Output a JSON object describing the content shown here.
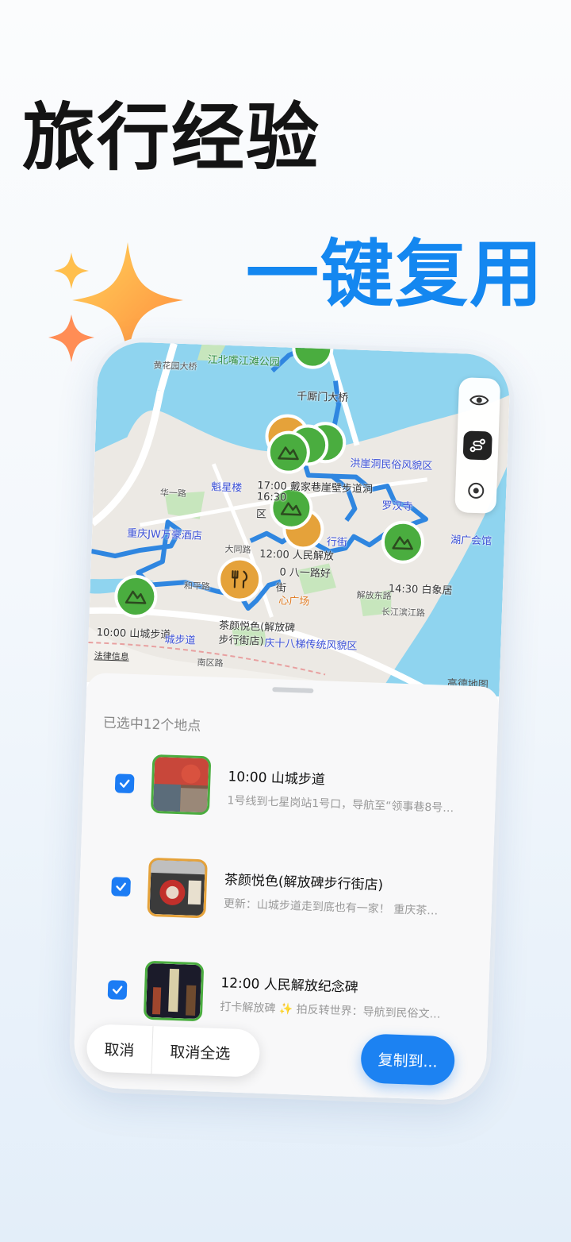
{
  "headline": {
    "line1": "旅行经验",
    "line2": "一键复用"
  },
  "colors": {
    "accent": "#1487f0",
    "route": "#2f86e0",
    "scenic": "#4aad3f",
    "food": "#e5a23a",
    "water": "#8fd4ef"
  },
  "map": {
    "labels": {
      "park": "江北嘴江滩公园",
      "bridge": "千厮门大桥",
      "road1": "黄花园大桥",
      "hongyadong": "洪崖洞民俗风貌区",
      "kuixinglou": "魁星楼",
      "stop_1700": "17:00 戴家巷崖壁步道洞",
      "stop_1630": "16:30",
      "district": "区",
      "luohan": "罗汉寺",
      "hotel": "重庆JW万豪酒店",
      "jiefangbei_short": "行街",
      "stop_1200": "12:00 人民解放",
      "bayi": "0 八一路好",
      "jie": "街",
      "square": "心广场",
      "huguang": "湖广会馆",
      "stop_1430": "14:30 白象居",
      "tea": "茶颜悦色(解放碑",
      "tea2": "步行街店)",
      "shiba": "庆十八梯传统风貌区",
      "stop_1000": "10:00 山城步道",
      "stop_1000b": "城步道",
      "road_hua": "华一路",
      "road_dayang": "大同路",
      "road_heping": "和平路",
      "road_nanqu": "南区路",
      "road_changbin": "长江滨江路",
      "road_jiefang": "解放东路",
      "legal": "法律信息",
      "provider": "高德地图"
    },
    "controls": [
      "eye-icon",
      "route-icon",
      "locate-icon"
    ]
  },
  "sheet": {
    "title": "已选中12个地点",
    "items": [
      {
        "title": "10:00 山城步道",
        "subtitle": "1号线到七星岗站1号口，导航至“领事巷8号…",
        "type": "scenic",
        "checked": true
      },
      {
        "title": "茶颜悦色(解放碑步行街店)",
        "subtitle": "更新：山城步道走到底也有一家！ 重庆茶…",
        "type": "food",
        "checked": true
      },
      {
        "title": "12:00 人民解放纪念碑",
        "subtitle": "打卡解放碑 ✨ 拍反转世界：导航到民俗文…",
        "type": "scenic",
        "checked": true
      }
    ]
  },
  "actions": {
    "cancel": "取消",
    "deselect_all": "取消全选",
    "copy_to": "复制到..."
  }
}
